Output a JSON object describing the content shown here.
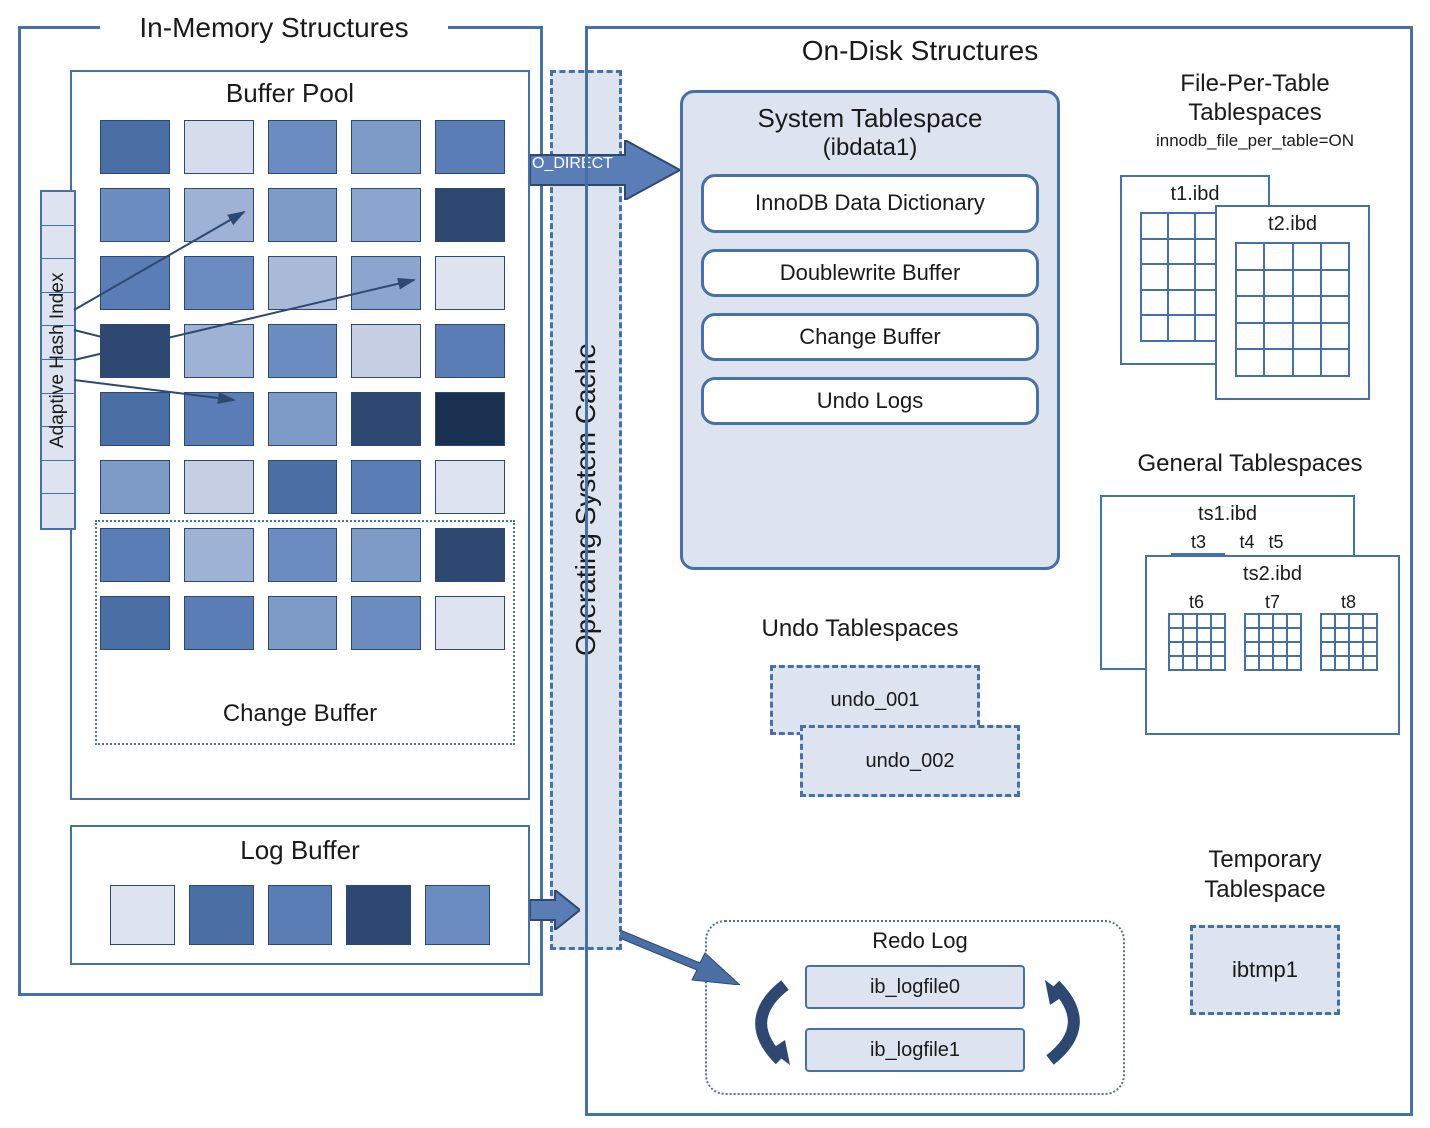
{
  "in_memory": {
    "title": "In-Memory Structures",
    "buffer_pool": "Buffer Pool",
    "change_buffer": "Change Buffer",
    "adaptive_hash_index": "Adaptive Hash Index",
    "log_buffer": "Log Buffer",
    "cells_row1": [
      "#4a6fa5",
      "#d5ddec",
      "#6a8cc0",
      "#7e9bc8",
      "#5a7db5"
    ],
    "cells_row2": [
      "#6a8cc0",
      "#9db2d4",
      "#7e9bc8",
      "#8aa5ce",
      "#2d4871"
    ],
    "cells_row3": [
      "#5a7db5",
      "#6a8cc0",
      "#a8bad8",
      "#8aa5ce",
      "#dde4f0"
    ],
    "cells_row4": [
      "#2d4871",
      "#9db2d4",
      "#6a8cc0",
      "#c5cee2",
      "#5a7db5"
    ],
    "cells_row5": [
      "#4a6fa5",
      "#5a7db5",
      "#7e9bc8",
      "#2d4871",
      "#1a3050"
    ],
    "cells_row6": [
      "#7e9bc8",
      "#c5cee2",
      "#4a6fa5",
      "#5a7db5",
      "#dde4f0"
    ],
    "cells_row7": [
      "#5a7db5",
      "#9db2d4",
      "#6a8cc0",
      "#7e9bc8",
      "#2d4871"
    ],
    "cells_row8": [
      "#4a6fa5",
      "#5a7db5",
      "#7e9bc8",
      "#6a8cc0",
      "#dde4f0"
    ],
    "log_cells": [
      "#dde4f0",
      "#4a6fa5",
      "#5a7db5",
      "#2d4871",
      "#6a8cc0"
    ]
  },
  "middle": {
    "o_direct": "O_DIRECT",
    "os_cache": "Operating System Cache"
  },
  "on_disk": {
    "title": "On-Disk Structures",
    "system_tablespace": {
      "title": "System Tablespace",
      "subtitle": "(ibdata1)",
      "items": [
        "InnoDB Data Dictionary",
        "Doublewrite Buffer",
        "Change Buffer",
        "Undo Logs"
      ]
    },
    "file_per_table": {
      "title": "File-Per-Table Tablespaces",
      "config": "innodb_file_per_table=ON",
      "files": [
        "t1.ibd",
        "t2.ibd"
      ]
    },
    "general_tablespaces": {
      "title": "General Tablespaces",
      "ts1": {
        "name": "ts1.ibd",
        "tables": [
          "t3",
          "t4",
          "t5"
        ]
      },
      "ts2": {
        "name": "ts2.ibd",
        "tables": [
          "t6",
          "t7",
          "t8"
        ]
      }
    },
    "undo": {
      "title": "Undo Tablespaces",
      "files": [
        "undo_001",
        "undo_002"
      ]
    },
    "redo": {
      "title": "Redo Log",
      "files": [
        "ib_logfile0",
        "ib_logfile1"
      ]
    },
    "temp": {
      "title": "Temporary Tablespace",
      "file": "ibtmp1"
    }
  }
}
